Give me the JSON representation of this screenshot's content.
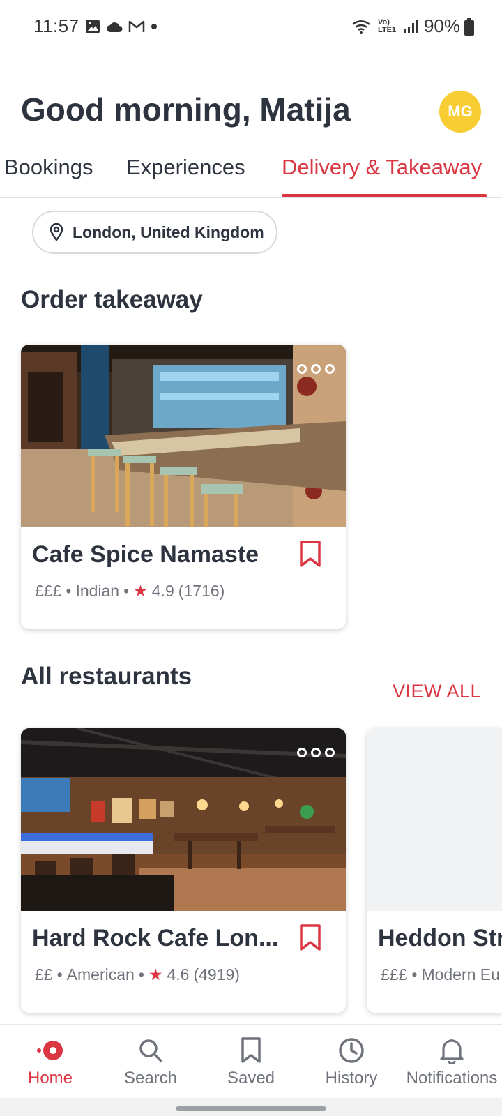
{
  "status_bar": {
    "time": "11:57",
    "battery_text": "90%",
    "network_text": "Vo) LTE1"
  },
  "header": {
    "greeting": "Good morning, Matija",
    "avatar_initials": "MG",
    "avatar_color": "#f8cd33"
  },
  "tabs": [
    {
      "label": "Bookings"
    },
    {
      "label": "Experiences"
    },
    {
      "label": "Delivery & Takeaway",
      "active": true
    }
  ],
  "location": {
    "label": "London, United Kingdom"
  },
  "sections": {
    "order_takeaway_title": "Order takeaway",
    "all_restaurants_title": "All restaurants",
    "view_all_label": "VIEW ALL"
  },
  "takeaway_cards": [
    {
      "name": "Cafe Spice Namaste",
      "price": "£££",
      "cuisine": "Indian",
      "rating": "4.9",
      "reviews": "(1716)"
    }
  ],
  "restaurant_cards": [
    {
      "name": "Hard Rock Cafe Lon...",
      "price": "££",
      "cuisine": "American",
      "rating": "4.6",
      "reviews": "(4919)"
    },
    {
      "name": "Heddon Str",
      "price": "£££",
      "cuisine": "Modern Eu"
    }
  ],
  "bottom_nav": [
    {
      "label": "Home",
      "icon": "home-icon",
      "active": true
    },
    {
      "label": "Search",
      "icon": "search-icon"
    },
    {
      "label": "Saved",
      "icon": "bookmark-icon"
    },
    {
      "label": "History",
      "icon": "clock-icon"
    },
    {
      "label": "Notifications",
      "icon": "bell-icon"
    }
  ],
  "colors": {
    "accent": "#da3743",
    "text_primary": "#2d333f",
    "text_secondary": "#6f737b"
  }
}
